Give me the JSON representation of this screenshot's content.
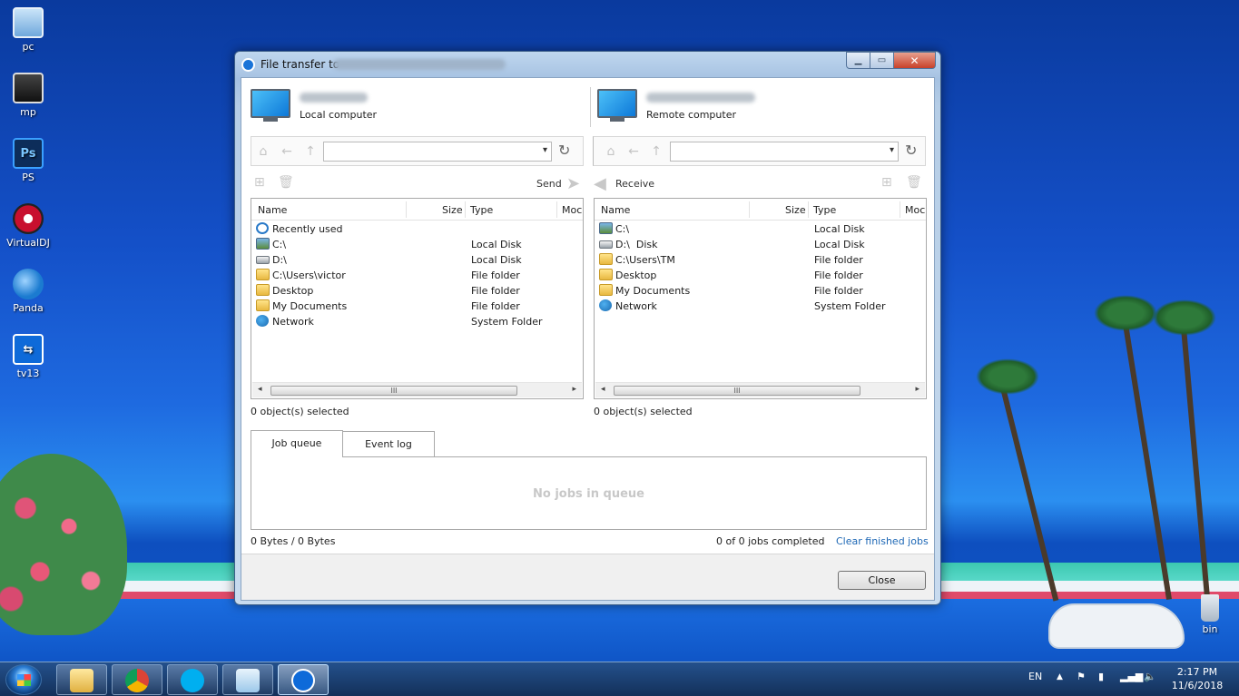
{
  "desktop": {
    "icons": [
      {
        "label": "pc",
        "icon": "computer-icon",
        "color": "#6fa8dc"
      },
      {
        "label": "mp",
        "icon": "media-player-icon",
        "color": "#2c2c2c"
      },
      {
        "label": "PS",
        "icon": "photoshop-icon",
        "color": "#0d3a7a"
      },
      {
        "label": "VirtualDJ",
        "icon": "virtualdj-icon",
        "color": "#c8102e"
      },
      {
        "label": "Panda",
        "icon": "panda-antivirus-icon",
        "color": "#1b7bd0"
      },
      {
        "label": "tv13",
        "icon": "teamviewer-icon",
        "color": "#0e6ad9"
      }
    ],
    "ps_glyph": "Ps",
    "recycle_label": "bin"
  },
  "window": {
    "title": "File transfer to",
    "buttons": {
      "minimize": "▁",
      "maximize": "▭",
      "close": "✕"
    }
  },
  "local": {
    "label": "Local computer",
    "send_label": "Send",
    "columns": {
      "name": "Name",
      "size": "Size",
      "type": "Type",
      "modified": "Moc"
    },
    "rows": [
      {
        "name": "Recently used",
        "type": "",
        "icon": "recent"
      },
      {
        "name": "C:\\",
        "type": "Local Disk",
        "icon": "sysdisk"
      },
      {
        "name": "D:\\",
        "type": "Local Disk",
        "icon": "disk"
      },
      {
        "name": "C:\\Users\\victor",
        "type": "File folder",
        "icon": "folder"
      },
      {
        "name": "Desktop",
        "type": "File folder",
        "icon": "folder"
      },
      {
        "name": "My Documents",
        "type": "File folder",
        "icon": "docs"
      },
      {
        "name": "Network",
        "type": "System Folder",
        "icon": "net"
      }
    ],
    "selected": "0 object(s) selected"
  },
  "remote": {
    "label": "Remote computer",
    "receive_label": "Receive",
    "columns": {
      "name": "Name",
      "size": "Size",
      "type": "Type",
      "modified": "Moc"
    },
    "rows": [
      {
        "name": "C:\\",
        "type": "Local Disk",
        "icon": "sysdisk"
      },
      {
        "name": "D:\\  Disk",
        "type": "Local Disk",
        "icon": "disk"
      },
      {
        "name": "C:\\Users\\TM",
        "type": "File folder",
        "icon": "folder"
      },
      {
        "name": "Desktop",
        "type": "File folder",
        "icon": "folder"
      },
      {
        "name": "My Documents",
        "type": "File folder",
        "icon": "docs"
      },
      {
        "name": "Network",
        "type": "System Folder",
        "icon": "net"
      }
    ],
    "selected": "0 object(s) selected"
  },
  "tabs": {
    "job_queue": "Job queue",
    "event_log": "Event log"
  },
  "queue": {
    "empty_text": "No jobs in queue",
    "bytes": "0 Bytes / 0 Bytes",
    "jobs": "0 of 0 jobs completed",
    "clear_link": "Clear finished jobs"
  },
  "close_label": "Close",
  "taskbar": {
    "language": "EN",
    "time": "2:17 PM",
    "date": "11/6/2018",
    "tray_up": "▲",
    "apps": [
      {
        "name": "explorer",
        "color": "#e8c05a"
      },
      {
        "name": "chrome",
        "color": "#dd4b39"
      },
      {
        "name": "skype",
        "color": "#00aff0"
      },
      {
        "name": "notepad",
        "color": "#a8d0f0"
      },
      {
        "name": "teamviewer",
        "color": "#0e6ad9"
      }
    ]
  },
  "scrollbar": {
    "left": "◂",
    "right": "▸",
    "grip": "III"
  },
  "glyphs": {
    "home": "⌂",
    "back": "←",
    "up": "↑",
    "dropdown": "▾",
    "refresh": "↻",
    "new_folder": "⊞",
    "delete": "🗑",
    "send_arrow": "➤",
    "receive_arrow": "◀"
  }
}
